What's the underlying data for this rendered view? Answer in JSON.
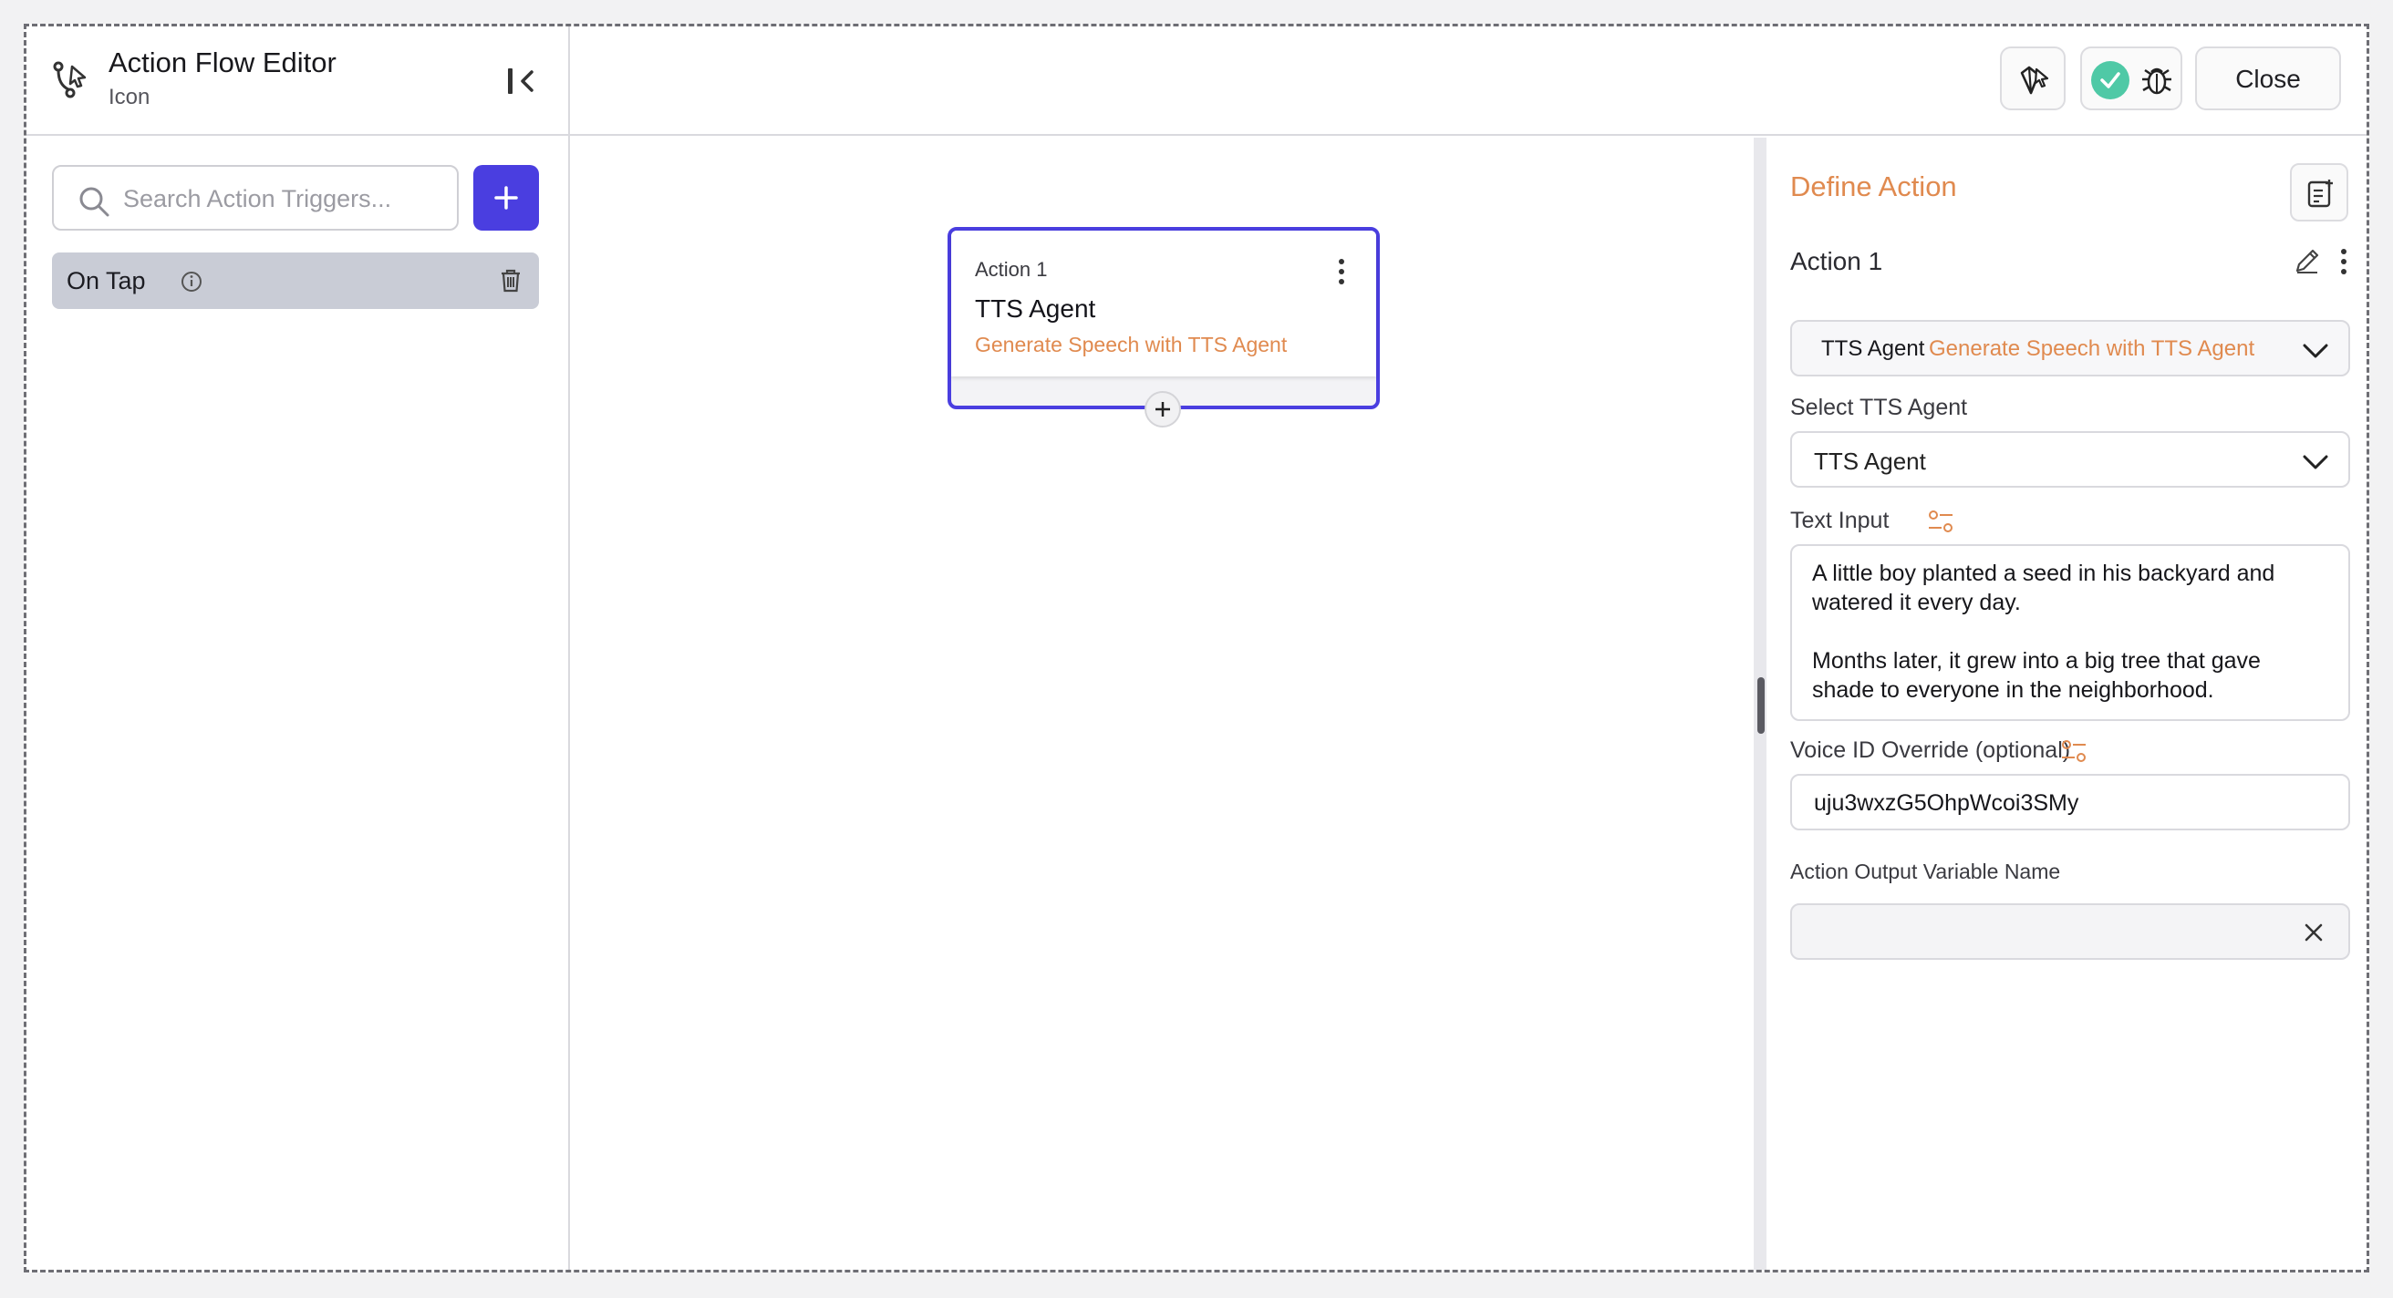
{
  "header": {
    "title": "Action Flow Editor",
    "subtitle": "Icon",
    "close_label": "Close"
  },
  "sidebar": {
    "search_placeholder": "Search Action Triggers...",
    "triggers": [
      {
        "label": "On Tap"
      }
    ]
  },
  "canvas": {
    "node": {
      "label": "Action 1",
      "title": "TTS Agent",
      "subtitle": "Generate Speech with TTS Agent"
    }
  },
  "panel": {
    "title": "Define Action",
    "action_name": "Action 1",
    "action_type": {
      "name": "TTS Agent",
      "description": "Generate Speech with TTS Agent"
    },
    "select_tts_label": "Select TTS Agent",
    "select_tts_value": "TTS Agent",
    "text_input_label": "Text Input",
    "text_input_value": "A little boy planted a seed in his backyard and watered it every day.\n\nMonths later, it grew into a big tree that gave shade to everyone in the neighborhood.",
    "voice_label": "Voice ID Override (optional)",
    "voice_value": "uju3wxzG5OhpWcoi3SMy",
    "output_label": "Action Output Variable Name",
    "output_value": ""
  },
  "colors": {
    "accent": "#4a3ee0",
    "orange": "#e08a4f",
    "status_ok": "#4fc9a6"
  }
}
